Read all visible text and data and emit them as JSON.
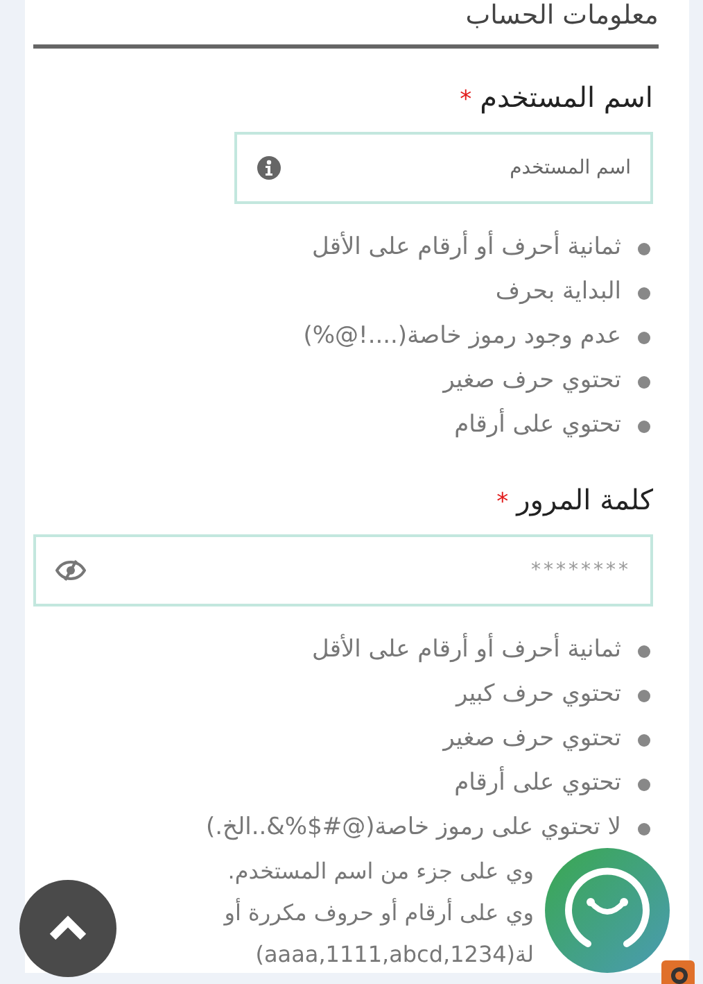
{
  "section_title": "معلومات الحساب",
  "username": {
    "label": "اسم المستخدم",
    "required_mark": "*",
    "placeholder": "اسم المستخدم"
  },
  "username_rules": [
    {
      "kind": "bullet",
      "text": "ثمانية أحرف أو أرقام على الأقل"
    },
    {
      "kind": "bullet",
      "text": "البداية بحرف"
    },
    {
      "kind": "bullet",
      "text": "عدم وجود رموز خاصة(....!@%)"
    },
    {
      "kind": "bullet",
      "text": "تحتوي حرف صغير"
    },
    {
      "kind": "bullet",
      "text": "تحتوي على أرقام"
    }
  ],
  "password": {
    "label": "كلمة المرور",
    "required_mark": "*",
    "value": "********"
  },
  "password_rules": [
    {
      "kind": "bullet",
      "text": "ثمانية أحرف أو أرقام على الأقل"
    },
    {
      "kind": "bullet",
      "text": "تحتوي حرف كبير"
    },
    {
      "kind": "bullet",
      "text": "تحتوي حرف صغير"
    },
    {
      "kind": "bullet",
      "text": "تحتوي على أرقام"
    },
    {
      "kind": "bullet",
      "text": "لا تحتوي على رموز خاصة(@#$%&..الخ.)"
    },
    {
      "kind": "covered",
      "text": "وي على جزء من اسم المستخدم."
    },
    {
      "kind": "covered",
      "text": "وي على أرقام أو حروف مكررة أو"
    },
    {
      "kind": "covered",
      "text": "لة(aaaa,1111,abcd,1234)"
    }
  ]
}
